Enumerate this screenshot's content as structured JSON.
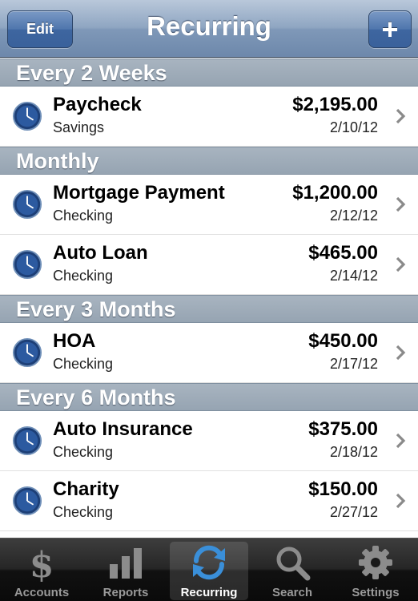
{
  "navbar": {
    "title": "Recurring",
    "edit_label": "Edit",
    "add_label": "+"
  },
  "sections": [
    {
      "header": "Every 2 Weeks",
      "rows": [
        {
          "name": "Paycheck",
          "account": "Savings",
          "amount": "$2,195.00",
          "date": "2/10/12"
        }
      ]
    },
    {
      "header": "Monthly",
      "rows": [
        {
          "name": "Mortgage Payment",
          "account": "Checking",
          "amount": "$1,200.00",
          "date": "2/12/12"
        },
        {
          "name": "Auto Loan",
          "account": "Checking",
          "amount": "$465.00",
          "date": "2/14/12"
        }
      ]
    },
    {
      "header": "Every 3 Months",
      "rows": [
        {
          "name": "HOA",
          "account": "Checking",
          "amount": "$450.00",
          "date": "2/17/12"
        }
      ]
    },
    {
      "header": "Every 6 Months",
      "rows": [
        {
          "name": "Auto Insurance",
          "account": "Checking",
          "amount": "$375.00",
          "date": "2/18/12"
        },
        {
          "name": "Charity",
          "account": "Checking",
          "amount": "$150.00",
          "date": "2/27/12"
        }
      ]
    }
  ],
  "tabbar": {
    "tabs": [
      {
        "label": "Accounts",
        "icon": "dollar-icon"
      },
      {
        "label": "Reports",
        "icon": "bar-chart-icon"
      },
      {
        "label": "Recurring",
        "icon": "recurring-arrows-icon",
        "active": true
      },
      {
        "label": "Search",
        "icon": "magnifier-icon"
      },
      {
        "label": "Settings",
        "icon": "gear-icon"
      }
    ]
  },
  "colors": {
    "navbar": "#8fa6c2",
    "section_header": "#9eacba",
    "tabbar": "#1a1a1a",
    "active_icon": "#3a8fd9"
  }
}
